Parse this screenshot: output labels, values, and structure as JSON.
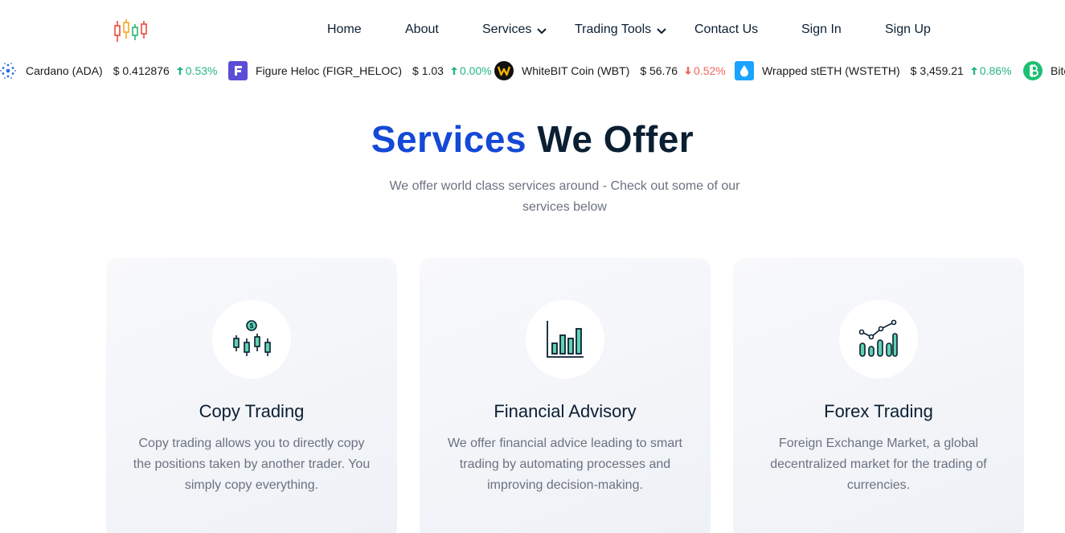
{
  "nav": {
    "home": "Home",
    "about": "About",
    "services": "Services",
    "trading_tools": "Trading Tools",
    "contact": "Contact Us",
    "sign_in": "Sign In",
    "sign_up": "Sign Up"
  },
  "ticker": [
    {
      "icon": "cardano-icon",
      "name": "Cardano (ADA)",
      "price": "$ 0.412876",
      "change": "0.53%",
      "direction": "up"
    },
    {
      "icon": "figure-heloc-icon",
      "name": "Figure Heloc (FIGR_HELOC)",
      "price": "$ 1.03",
      "change": "0.00%",
      "direction": "up"
    },
    {
      "icon": "whitebit-icon",
      "name": "WhiteBIT Coin (WBT)",
      "price": "$ 56.76",
      "change": "0.52%",
      "direction": "down"
    },
    {
      "icon": "wrapped-steth-icon",
      "name": "Wrapped stETH (WSTETH)",
      "price": "$ 3,459.21",
      "change": "0.86%",
      "direction": "up"
    },
    {
      "icon": "bitcoin-cash-icon",
      "name": "Bitc",
      "price": "",
      "change": "",
      "direction": ""
    }
  ],
  "section": {
    "title_accent": "Services",
    "title_rest": "We Offer",
    "subtitle": "We offer world class services around - Check out some of our services below"
  },
  "cards": [
    {
      "icon": "candlestick-dollar-icon",
      "title": "Copy Trading",
      "text": "Copy trading allows you to directly copy the positions taken by another trader. You simply copy everything."
    },
    {
      "icon": "bar-chart-icon",
      "title": "Financial Advisory",
      "text": "We offer financial advice leading to smart trading by automating processes and improving decision-making."
    },
    {
      "icon": "growth-chart-icon",
      "title": "Forex Trading",
      "text": "Foreign Exchange Market, a global decentralized market for the trading of currencies."
    }
  ],
  "colors": {
    "accent": "#1449d6",
    "navy": "#0b1f33",
    "up": "#26b38a",
    "down": "#f0665c",
    "icon_green": "#5fd3b0"
  }
}
